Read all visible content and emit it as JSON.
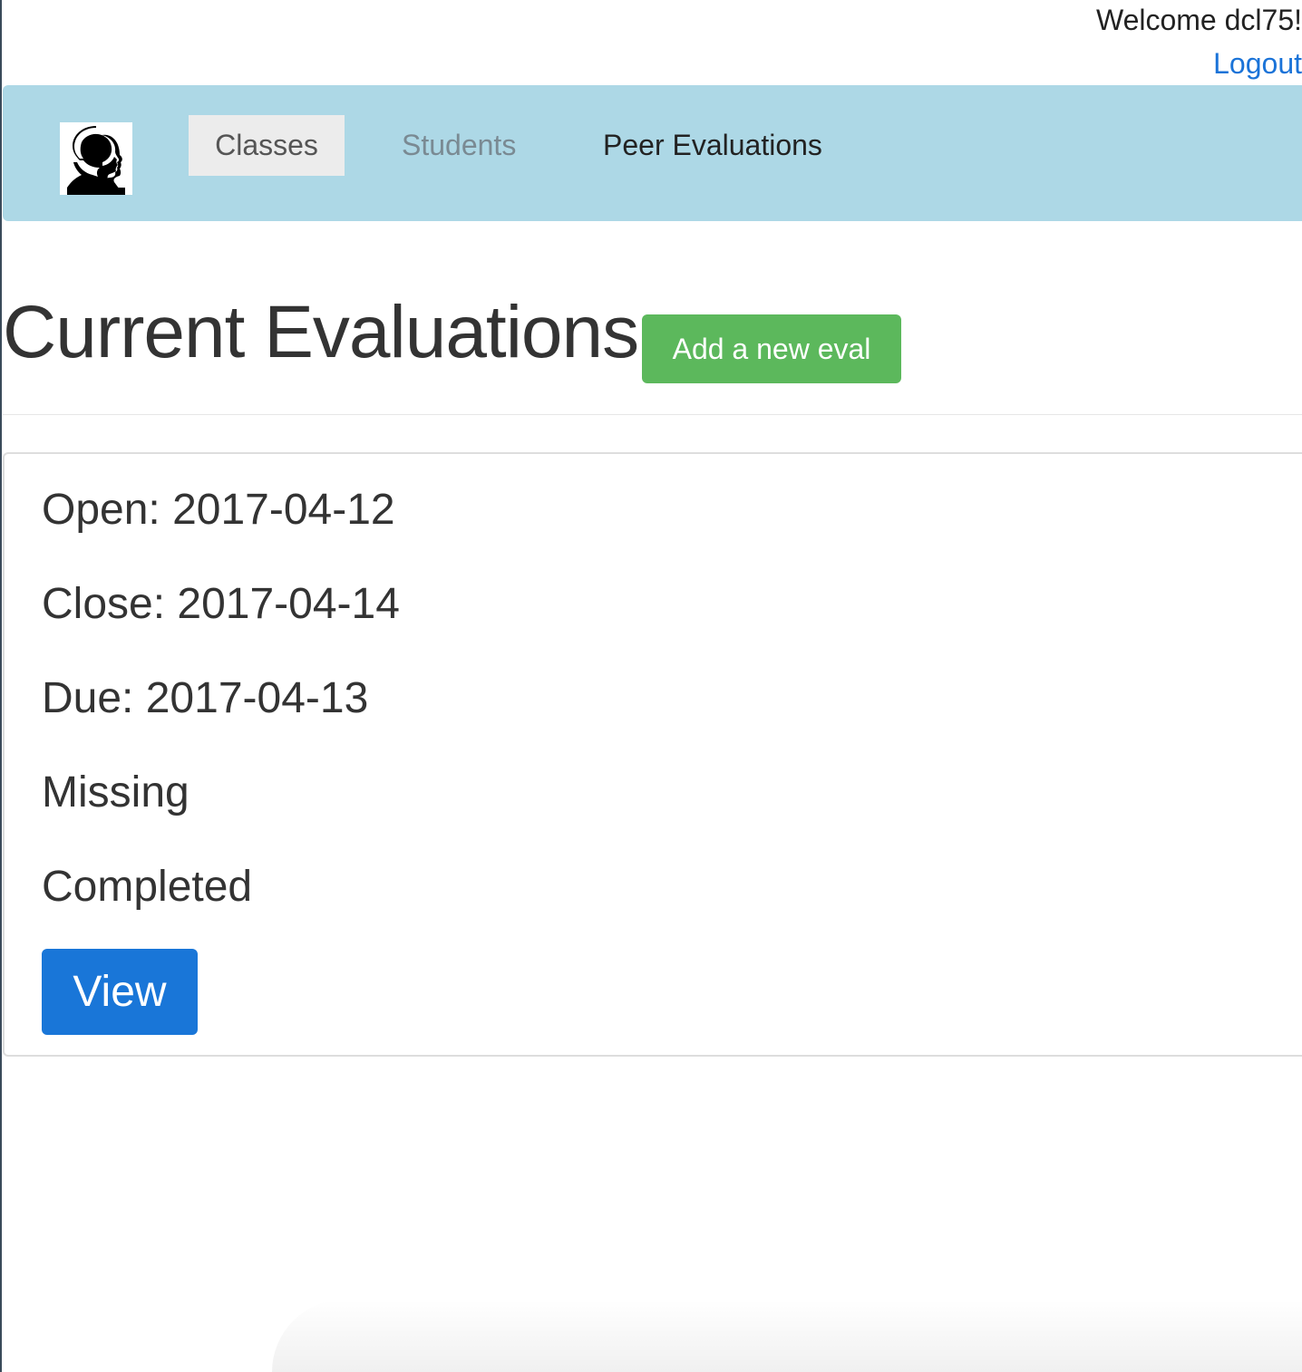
{
  "header": {
    "welcome_text": "Welcome dcl75!",
    "logout_label": "Logout"
  },
  "navbar": {
    "logo_icon": "profile-silhouette-icon",
    "items": [
      {
        "label": "Classes",
        "state": "active"
      },
      {
        "label": "Students",
        "state": "muted"
      },
      {
        "label": "Peer Evaluations",
        "state": "normal"
      }
    ]
  },
  "main": {
    "title": "Current Evaluations",
    "add_button_label": "Add a new eval"
  },
  "evaluation": {
    "open": "Open: 2017-04-12",
    "close": "Close: 2017-04-14",
    "due": "Due: 2017-04-13",
    "missing": "Missing",
    "completed": "Completed",
    "view_button_label": "View"
  },
  "colors": {
    "navbar_bg": "#add8e6",
    "add_button": "#5cb85c",
    "view_button": "#1976d8",
    "link": "#1a73d8"
  }
}
